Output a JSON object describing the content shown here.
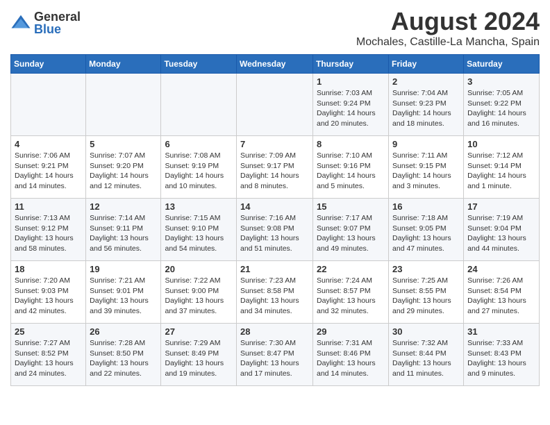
{
  "header": {
    "logo_general": "General",
    "logo_blue": "Blue",
    "title": "August 2024",
    "subtitle": "Mochales, Castille-La Mancha, Spain"
  },
  "days_of_week": [
    "Sunday",
    "Monday",
    "Tuesday",
    "Wednesday",
    "Thursday",
    "Friday",
    "Saturday"
  ],
  "weeks": [
    {
      "days": [
        {
          "num": "",
          "info": ""
        },
        {
          "num": "",
          "info": ""
        },
        {
          "num": "",
          "info": ""
        },
        {
          "num": "",
          "info": ""
        },
        {
          "num": "1",
          "info": "Sunrise: 7:03 AM\nSunset: 9:24 PM\nDaylight: 14 hours\nand 20 minutes."
        },
        {
          "num": "2",
          "info": "Sunrise: 7:04 AM\nSunset: 9:23 PM\nDaylight: 14 hours\nand 18 minutes."
        },
        {
          "num": "3",
          "info": "Sunrise: 7:05 AM\nSunset: 9:22 PM\nDaylight: 14 hours\nand 16 minutes."
        }
      ]
    },
    {
      "days": [
        {
          "num": "4",
          "info": "Sunrise: 7:06 AM\nSunset: 9:21 PM\nDaylight: 14 hours\nand 14 minutes."
        },
        {
          "num": "5",
          "info": "Sunrise: 7:07 AM\nSunset: 9:20 PM\nDaylight: 14 hours\nand 12 minutes."
        },
        {
          "num": "6",
          "info": "Sunrise: 7:08 AM\nSunset: 9:19 PM\nDaylight: 14 hours\nand 10 minutes."
        },
        {
          "num": "7",
          "info": "Sunrise: 7:09 AM\nSunset: 9:17 PM\nDaylight: 14 hours\nand 8 minutes."
        },
        {
          "num": "8",
          "info": "Sunrise: 7:10 AM\nSunset: 9:16 PM\nDaylight: 14 hours\nand 5 minutes."
        },
        {
          "num": "9",
          "info": "Sunrise: 7:11 AM\nSunset: 9:15 PM\nDaylight: 14 hours\nand 3 minutes."
        },
        {
          "num": "10",
          "info": "Sunrise: 7:12 AM\nSunset: 9:14 PM\nDaylight: 14 hours\nand 1 minute."
        }
      ]
    },
    {
      "days": [
        {
          "num": "11",
          "info": "Sunrise: 7:13 AM\nSunset: 9:12 PM\nDaylight: 13 hours\nand 58 minutes."
        },
        {
          "num": "12",
          "info": "Sunrise: 7:14 AM\nSunset: 9:11 PM\nDaylight: 13 hours\nand 56 minutes."
        },
        {
          "num": "13",
          "info": "Sunrise: 7:15 AM\nSunset: 9:10 PM\nDaylight: 13 hours\nand 54 minutes."
        },
        {
          "num": "14",
          "info": "Sunrise: 7:16 AM\nSunset: 9:08 PM\nDaylight: 13 hours\nand 51 minutes."
        },
        {
          "num": "15",
          "info": "Sunrise: 7:17 AM\nSunset: 9:07 PM\nDaylight: 13 hours\nand 49 minutes."
        },
        {
          "num": "16",
          "info": "Sunrise: 7:18 AM\nSunset: 9:05 PM\nDaylight: 13 hours\nand 47 minutes."
        },
        {
          "num": "17",
          "info": "Sunrise: 7:19 AM\nSunset: 9:04 PM\nDaylight: 13 hours\nand 44 minutes."
        }
      ]
    },
    {
      "days": [
        {
          "num": "18",
          "info": "Sunrise: 7:20 AM\nSunset: 9:03 PM\nDaylight: 13 hours\nand 42 minutes."
        },
        {
          "num": "19",
          "info": "Sunrise: 7:21 AM\nSunset: 9:01 PM\nDaylight: 13 hours\nand 39 minutes."
        },
        {
          "num": "20",
          "info": "Sunrise: 7:22 AM\nSunset: 9:00 PM\nDaylight: 13 hours\nand 37 minutes."
        },
        {
          "num": "21",
          "info": "Sunrise: 7:23 AM\nSunset: 8:58 PM\nDaylight: 13 hours\nand 34 minutes."
        },
        {
          "num": "22",
          "info": "Sunrise: 7:24 AM\nSunset: 8:57 PM\nDaylight: 13 hours\nand 32 minutes."
        },
        {
          "num": "23",
          "info": "Sunrise: 7:25 AM\nSunset: 8:55 PM\nDaylight: 13 hours\nand 29 minutes."
        },
        {
          "num": "24",
          "info": "Sunrise: 7:26 AM\nSunset: 8:54 PM\nDaylight: 13 hours\nand 27 minutes."
        }
      ]
    },
    {
      "days": [
        {
          "num": "25",
          "info": "Sunrise: 7:27 AM\nSunset: 8:52 PM\nDaylight: 13 hours\nand 24 minutes."
        },
        {
          "num": "26",
          "info": "Sunrise: 7:28 AM\nSunset: 8:50 PM\nDaylight: 13 hours\nand 22 minutes."
        },
        {
          "num": "27",
          "info": "Sunrise: 7:29 AM\nSunset: 8:49 PM\nDaylight: 13 hours\nand 19 minutes."
        },
        {
          "num": "28",
          "info": "Sunrise: 7:30 AM\nSunset: 8:47 PM\nDaylight: 13 hours\nand 17 minutes."
        },
        {
          "num": "29",
          "info": "Sunrise: 7:31 AM\nSunset: 8:46 PM\nDaylight: 13 hours\nand 14 minutes."
        },
        {
          "num": "30",
          "info": "Sunrise: 7:32 AM\nSunset: 8:44 PM\nDaylight: 13 hours\nand 11 minutes."
        },
        {
          "num": "31",
          "info": "Sunrise: 7:33 AM\nSunset: 8:43 PM\nDaylight: 13 hours\nand 9 minutes."
        }
      ]
    }
  ]
}
